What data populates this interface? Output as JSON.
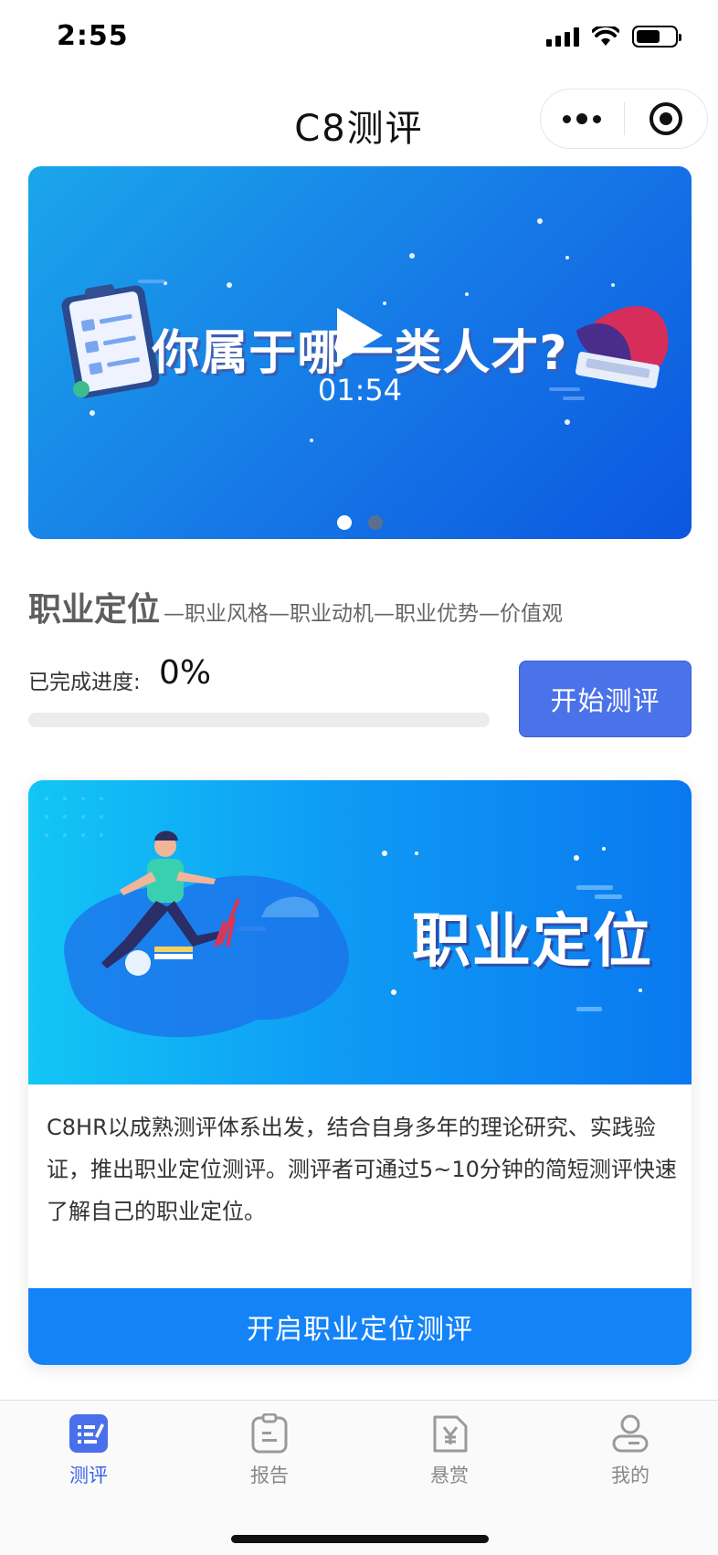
{
  "status_bar": {
    "time": "2:55"
  },
  "nav": {
    "title": "C8测评"
  },
  "video": {
    "headline": "你属于哪一类人才?",
    "duration": "01:54",
    "slides": 2,
    "active_slide": 1
  },
  "career": {
    "title": "职业定位",
    "subtitle": "—职业风格—职业动机—职业优势—价值观",
    "progress_label": "已完成进度:",
    "progress_value": "0%",
    "progress_fraction": 0,
    "start_button": "开始测评"
  },
  "card": {
    "banner_title": "职业定位",
    "description": "C8HR以成熟测评体系出发，结合自身多年的理论研究、实践验证，推出职业定位测评。测评者可通过5~10分钟的简短测评快速了解自己的职业定位。",
    "cta": "开启职业定位测评"
  },
  "tabs": [
    {
      "label": "测评",
      "icon": "assessment-icon",
      "active": true
    },
    {
      "label": "报告",
      "icon": "report-icon",
      "active": false
    },
    {
      "label": "悬赏",
      "icon": "reward-icon",
      "active": false
    },
    {
      "label": "我的",
      "icon": "profile-icon",
      "active": false
    }
  ],
  "colors": {
    "accent": "#4a72e9",
    "cta_blue": "#1483f8",
    "tab_active": "#3a63e8"
  }
}
